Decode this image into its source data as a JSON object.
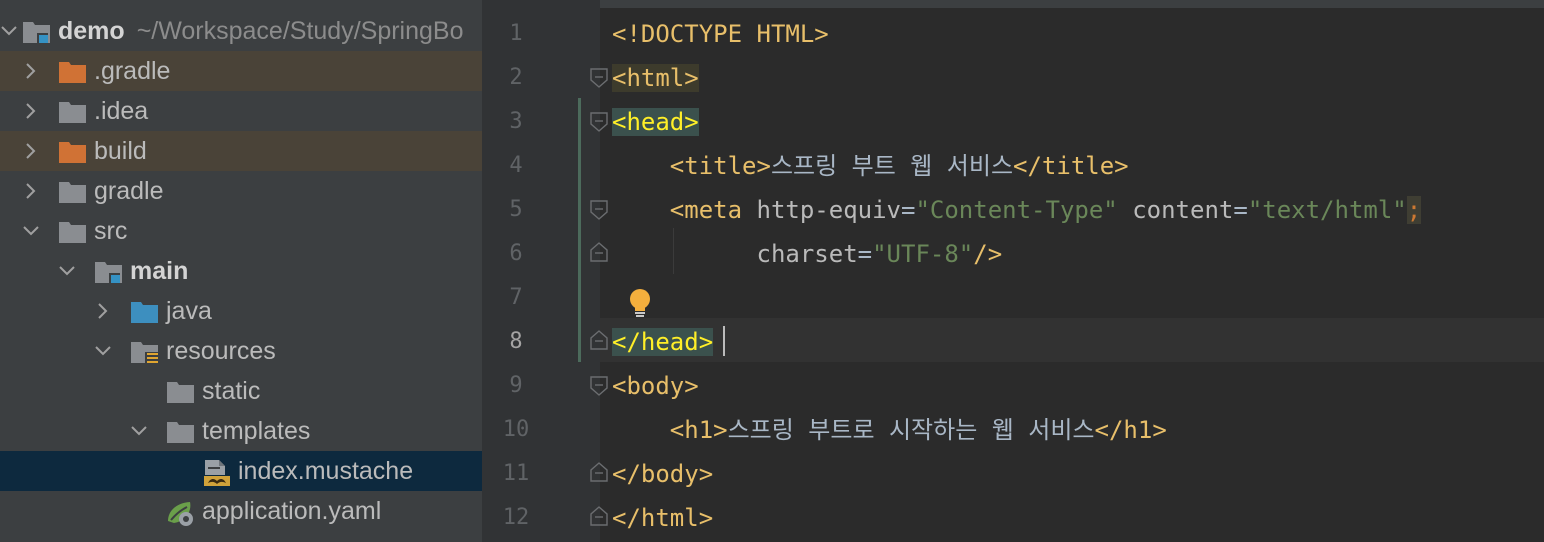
{
  "project_tree": {
    "root": {
      "name": "demo",
      "path": "~/Workspace/Study/SpringBo"
    },
    "items": [
      {
        "label": ".gradle"
      },
      {
        "label": ".idea"
      },
      {
        "label": "build"
      },
      {
        "label": "gradle"
      },
      {
        "label": "src"
      },
      {
        "label": "main"
      },
      {
        "label": "java"
      },
      {
        "label": "resources"
      },
      {
        "label": "static"
      },
      {
        "label": "templates"
      },
      {
        "label": "index.mustache"
      },
      {
        "label": "application.yaml"
      }
    ]
  },
  "editor": {
    "line_numbers": [
      "1",
      "2",
      "3",
      "4",
      "5",
      "6",
      "7",
      "8",
      "9",
      "10",
      "11",
      "12"
    ],
    "current_line": "8",
    "lines": {
      "l1": {
        "doctype": "<!DOCTYPE HTML>"
      },
      "l2": {
        "open": "<html>"
      },
      "l3": {
        "open": "<head>"
      },
      "l4": {
        "indent": "    ",
        "open": "<title>",
        "text": "스프링 부트 웹 서비스",
        "close": "</title>"
      },
      "l5": {
        "indent": "    ",
        "open": "<meta",
        "sp1": " ",
        "attr1": "http-equiv",
        "eq1": "=",
        "val1": "\"Content-Type\"",
        "sp2": " ",
        "attr2": "content",
        "eq2": "=",
        "val2": "\"text/html\"",
        "semi": ";"
      },
      "l6": {
        "indent": "          ",
        "attr": "charset",
        "eq": "=",
        "val": "\"UTF-8\"",
        "close": "/>"
      },
      "l8": {
        "close": "</head>"
      },
      "l9": {
        "open": "<body>"
      },
      "l10": {
        "indent": "    ",
        "open": "<h1>",
        "text": "스프링 부트로 시작하는 웹 서비스",
        "close": "</h1>"
      },
      "l11": {
        "close": "</body>"
      },
      "l12": {
        "close": "</html>"
      }
    }
  },
  "colors": {
    "tree_bg": "#3c3f41",
    "excluded_row": "#4a4338",
    "selected_row": "#0d293e",
    "editor_bg": "#2b2b2b",
    "tag": "#e8bf6a",
    "string": "#6a8759",
    "matched_tag_bg": "#3b514d",
    "matched_tag_fg": "#ffef28"
  },
  "icons": {
    "chevron_right": "chevron-right-icon",
    "chevron_down": "chevron-down-icon",
    "folder": "folder-icon",
    "module": "module-folder-icon",
    "mustache_file": "mustache-file-icon",
    "spring_yaml": "spring-yaml-icon",
    "intention_bulb": "lightbulb-icon",
    "fold": "fold-marker-icon"
  }
}
